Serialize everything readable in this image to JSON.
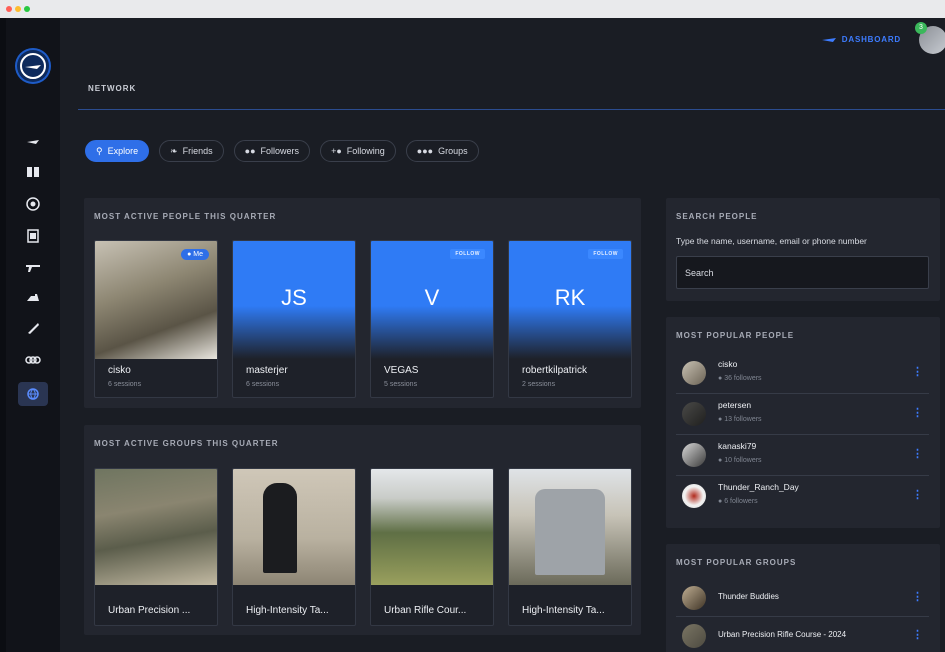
{
  "header": {
    "dashboard_label": "DASHBOARD",
    "notification_count": "3"
  },
  "page": {
    "title": "NETWORK"
  },
  "tabs": [
    {
      "label": "Explore",
      "icon": "search-icon",
      "active": true
    },
    {
      "label": "Friends",
      "icon": "handshake-icon",
      "active": false
    },
    {
      "label": "Followers",
      "icon": "people-icon",
      "active": false
    },
    {
      "label": "Following",
      "icon": "person-add-icon",
      "active": false
    },
    {
      "label": "Groups",
      "icon": "group-icon",
      "active": false
    }
  ],
  "people_panel": {
    "title": "MOST ACTIVE PEOPLE THIS QUARTER",
    "people": [
      {
        "name": "cisko",
        "sessions": "6 sessions",
        "badge": "Me",
        "photo": true
      },
      {
        "name": "masterjer",
        "sessions": "6 sessions",
        "initials": "JS"
      },
      {
        "name": "VEGAS",
        "sessions": "5 sessions",
        "initials": "V",
        "badge": "FOLLOW"
      },
      {
        "name": "robertkilpatrick",
        "sessions": "2 sessions",
        "initials": "RK",
        "badge": "FOLLOW"
      }
    ]
  },
  "groups_panel": {
    "title": "MOST ACTIVE GROUPS THIS QUARTER",
    "groups": [
      {
        "name": "Urban Precision ..."
      },
      {
        "name": "High-Intensity Ta..."
      },
      {
        "name": "Urban Rifle Cour..."
      },
      {
        "name": "High-Intensity Ta..."
      }
    ]
  },
  "search_panel": {
    "title": "SEARCH PEOPLE",
    "label": "Type the name, username, email or phone number",
    "placeholder": "Search"
  },
  "popular_people": {
    "title": "MOST POPULAR PEOPLE",
    "items": [
      {
        "name": "cisko",
        "followers": "36 followers"
      },
      {
        "name": "petersen",
        "followers": "13 followers"
      },
      {
        "name": "kanaski79",
        "followers": "10 followers"
      },
      {
        "name": "Thunder_Ranch_Day",
        "followers": "6 followers"
      }
    ]
  },
  "popular_groups": {
    "title": "MOST POPULAR GROUPS",
    "items": [
      {
        "name": "Thunder Buddies"
      },
      {
        "name": "Urban Precision Rifle Course - 2024"
      }
    ]
  },
  "colors": {
    "accent": "#2f6fe8",
    "card_blue": "#2f7bf5",
    "background": "#1a1d24",
    "panel": "#23262f"
  },
  "sidebar": {
    "items": [
      {
        "icon": "logo-swoosh-icon"
      },
      {
        "icon": "book-icon"
      },
      {
        "icon": "target-icon"
      },
      {
        "icon": "scorecard-icon"
      },
      {
        "icon": "rifle-icon"
      },
      {
        "icon": "pistol-icon"
      },
      {
        "icon": "knife-icon"
      },
      {
        "icon": "rings-icon"
      },
      {
        "icon": "globe-icon",
        "active": true
      }
    ]
  }
}
